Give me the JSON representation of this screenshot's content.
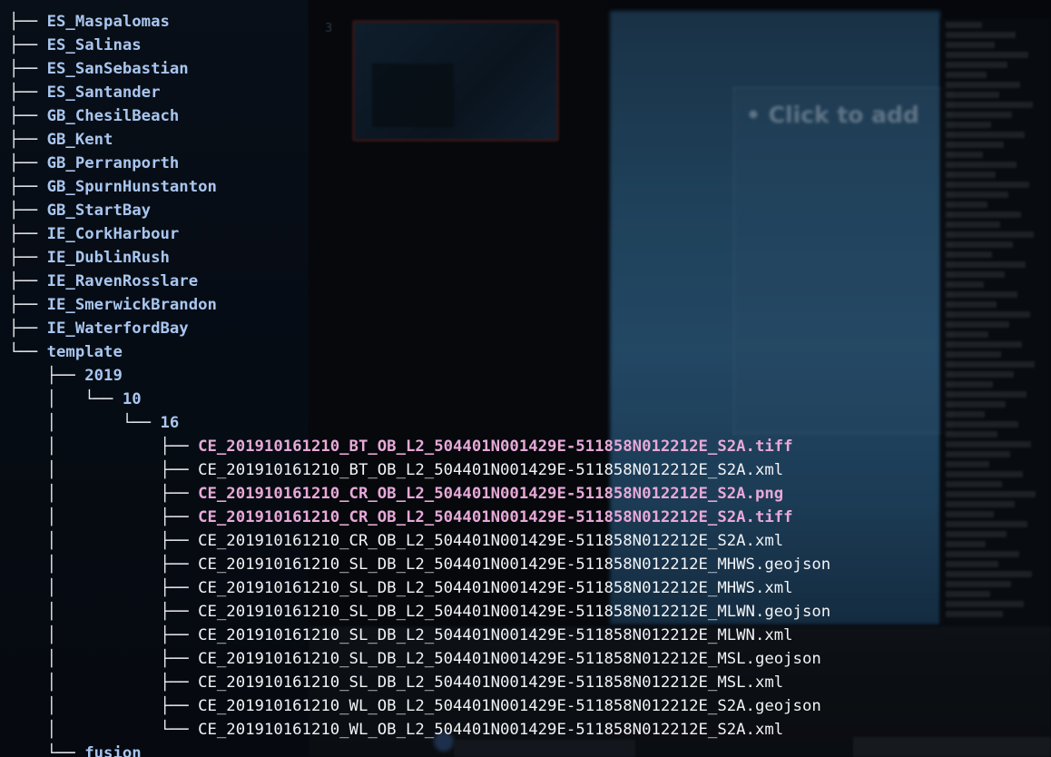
{
  "background": {
    "slide_number": "3",
    "slide_placeholder": "• Click to add"
  },
  "colors": {
    "directory": "#a8c6ef",
    "plain_file": "#f1f3f6",
    "media_file": "#e7a9d8",
    "branch": "#eef1f5",
    "terminal_background": "#06080d"
  },
  "tree": {
    "lines": [
      {
        "prefix": "├── ",
        "name": "ES_Maspalomas",
        "kind": "dir"
      },
      {
        "prefix": "├── ",
        "name": "ES_Salinas",
        "kind": "dir"
      },
      {
        "prefix": "├── ",
        "name": "ES_SanSebastian",
        "kind": "dir"
      },
      {
        "prefix": "├── ",
        "name": "ES_Santander",
        "kind": "dir"
      },
      {
        "prefix": "├── ",
        "name": "GB_ChesilBeach",
        "kind": "dir"
      },
      {
        "prefix": "├── ",
        "name": "GB_Kent",
        "kind": "dir"
      },
      {
        "prefix": "├── ",
        "name": "GB_Perranporth",
        "kind": "dir"
      },
      {
        "prefix": "├── ",
        "name": "GB_SpurnHunstanton",
        "kind": "dir"
      },
      {
        "prefix": "├── ",
        "name": "GB_StartBay",
        "kind": "dir"
      },
      {
        "prefix": "├── ",
        "name": "IE_CorkHarbour",
        "kind": "dir"
      },
      {
        "prefix": "├── ",
        "name": "IE_DublinRush",
        "kind": "dir"
      },
      {
        "prefix": "├── ",
        "name": "IE_RavenRosslare",
        "kind": "dir"
      },
      {
        "prefix": "├── ",
        "name": "IE_SmerwickBrandon",
        "kind": "dir"
      },
      {
        "prefix": "├── ",
        "name": "IE_WaterfordBay",
        "kind": "dir"
      },
      {
        "prefix": "└── ",
        "name": "template",
        "kind": "dir"
      },
      {
        "prefix": "    ├── ",
        "name": "2019",
        "kind": "dir"
      },
      {
        "prefix": "    │   └── ",
        "name": "10",
        "kind": "dir"
      },
      {
        "prefix": "    │       └── ",
        "name": "16",
        "kind": "dir"
      },
      {
        "prefix": "    │           ├── ",
        "name": "CE_201910161210_BT_OB_L2_504401N001429E-511858N012212E_S2A.tiff",
        "kind": "media"
      },
      {
        "prefix": "    │           ├── ",
        "name": "CE_201910161210_BT_OB_L2_504401N001429E-511858N012212E_S2A.xml",
        "kind": "file"
      },
      {
        "prefix": "    │           ├── ",
        "name": "CE_201910161210_CR_OB_L2_504401N001429E-511858N012212E_S2A.png",
        "kind": "media"
      },
      {
        "prefix": "    │           ├── ",
        "name": "CE_201910161210_CR_OB_L2_504401N001429E-511858N012212E_S2A.tiff",
        "kind": "media"
      },
      {
        "prefix": "    │           ├── ",
        "name": "CE_201910161210_CR_OB_L2_504401N001429E-511858N012212E_S2A.xml",
        "kind": "file"
      },
      {
        "prefix": "    │           ├── ",
        "name": "CE_201910161210_SL_DB_L2_504401N001429E-511858N012212E_MHWS.geojson",
        "kind": "file"
      },
      {
        "prefix": "    │           ├── ",
        "name": "CE_201910161210_SL_DB_L2_504401N001429E-511858N012212E_MHWS.xml",
        "kind": "file"
      },
      {
        "prefix": "    │           ├── ",
        "name": "CE_201910161210_SL_DB_L2_504401N001429E-511858N012212E_MLWN.geojson",
        "kind": "file"
      },
      {
        "prefix": "    │           ├── ",
        "name": "CE_201910161210_SL_DB_L2_504401N001429E-511858N012212E_MLWN.xml",
        "kind": "file"
      },
      {
        "prefix": "    │           ├── ",
        "name": "CE_201910161210_SL_DB_L2_504401N001429E-511858N012212E_MSL.geojson",
        "kind": "file"
      },
      {
        "prefix": "    │           ├── ",
        "name": "CE_201910161210_SL_DB_L2_504401N001429E-511858N012212E_MSL.xml",
        "kind": "file"
      },
      {
        "prefix": "    │           ├── ",
        "name": "CE_201910161210_WL_OB_L2_504401N001429E-511858N012212E_S2A.geojson",
        "kind": "file"
      },
      {
        "prefix": "    │           └── ",
        "name": "CE_201910161210_WL_OB_L2_504401N001429E-511858N012212E_S2A.xml",
        "kind": "file"
      },
      {
        "prefix": "    └── ",
        "name": "fusion",
        "kind": "dir"
      }
    ]
  }
}
